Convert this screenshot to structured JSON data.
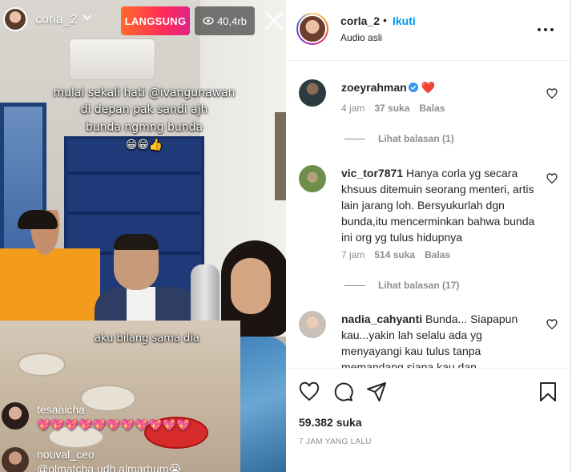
{
  "live": {
    "host_username": "corla_2",
    "live_badge": "LANGSUNG",
    "viewer_count": "40,4rb",
    "caption_lines": [
      "mulai sekali hati @ivangunawan",
      "di depan pak sandi ajh",
      "bunda ngmng bunda",
      "😁😁👍"
    ],
    "caption_mid": "aku bilang sama dia",
    "comments": [
      {
        "username": "tesaaicha",
        "text": "💖💖💖💖💖💖💖💖💖💖💖"
      },
      {
        "username": "nouval_ceo",
        "text": "@olmatcha udh almarhum😭"
      }
    ]
  },
  "post": {
    "username": "corla_2",
    "separator": "•",
    "follow_label": "Ikuti",
    "audio_label": "Audio asli",
    "comments": [
      {
        "username": "zoeyrahman",
        "text": "❤️",
        "verified": true,
        "time": "4 jam",
        "likes": "37 suka",
        "reply_label": "Balas",
        "replies_label": "Lihat balasan (1)"
      },
      {
        "username": "vic_tor7871",
        "text": "Hanya corla yg secara khsuus ditemuin seorang menteri, artis lain jarang loh. Bersyukurlah dgn bunda,itu mencerminkan bahwa bunda ini org yg tulus hidupnya",
        "verified": false,
        "time": "7 jam",
        "likes": "514 suka",
        "reply_label": "Balas",
        "replies_label": "Lihat balasan (17)"
      },
      {
        "username": "nadia_cahyanti",
        "text": "Bunda... Siapapun kau...yakin lah selalu ada yg menyayangi kau tulus tanpa memandang siapa kau dan",
        "verified": false
      }
    ],
    "like_count": "59.382 suka",
    "timestamp": "7 JAM YANG LALU"
  },
  "colors": {
    "live_gradient_start": "#ff6a2b",
    "live_gradient_end": "#e0228a",
    "follow_blue": "#0095f6",
    "verified_blue": "#3897f0",
    "heart_red": "#ed4956",
    "muted_text": "#8e8e8e"
  },
  "icons": [
    "chevron-down-icon",
    "eye-icon",
    "close-icon",
    "more-icon",
    "heart-outline-icon",
    "comment-icon",
    "share-icon",
    "bookmark-icon",
    "verified-icon"
  ]
}
